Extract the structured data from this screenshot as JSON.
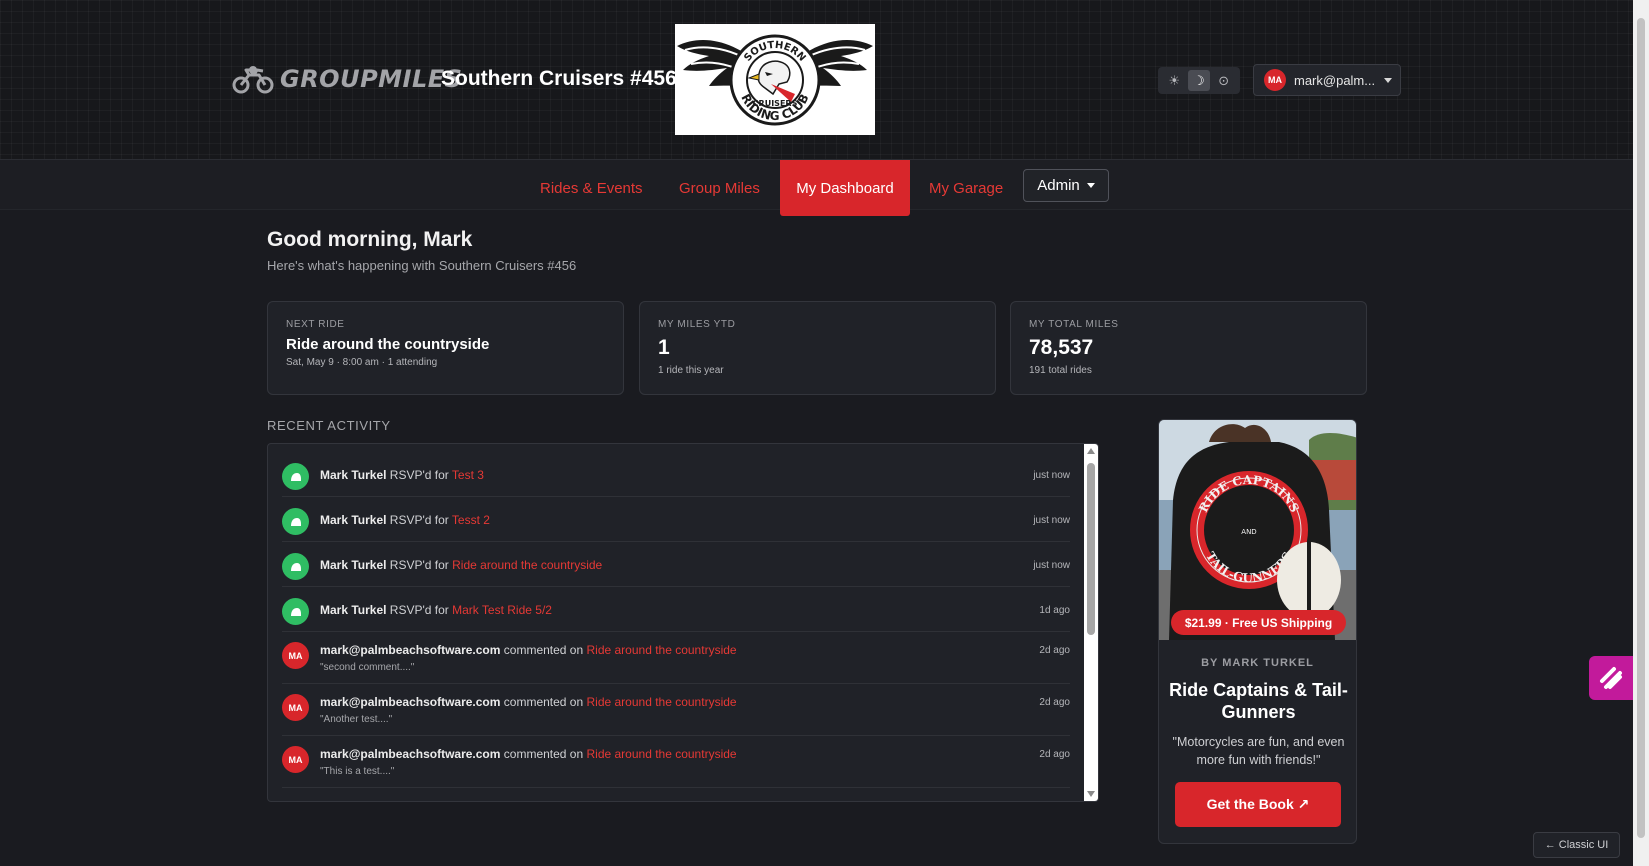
{
  "header": {
    "brand_name": "GROUPMILES",
    "club_name": "Southern Cruisers #456",
    "club_logo": {
      "top_text": "SOUTHERN",
      "center_text": "CRUISERS",
      "bottom_text": "RIDING CLUB"
    },
    "theme_toggle": {
      "light_icon": "sun-icon",
      "dark_icon": "moon-icon",
      "system_icon": "system-icon",
      "active": "dark"
    },
    "user": {
      "avatar_initials": "MA",
      "email": "mark@palm..."
    }
  },
  "nav": {
    "items": [
      {
        "label": "Rides & Events"
      },
      {
        "label": "Group Miles"
      },
      {
        "label": "My Dashboard"
      },
      {
        "label": "My Garage"
      }
    ],
    "active": "My Dashboard",
    "admin_label": "Admin"
  },
  "greeting": {
    "title": "Good morning, Mark",
    "subtitle": "Here's what's happening with Southern Cruisers #456"
  },
  "stats": {
    "next_ride": {
      "label": "NEXT RIDE",
      "title": "Ride around the countryside",
      "meta": "Sat, May 9 · 8:00 am · 1 attending"
    },
    "miles_ytd": {
      "label": "MY MILES YTD",
      "value": "1",
      "sub": "1 ride this year"
    },
    "total_miles": {
      "label": "MY TOTAL MILES",
      "value": "78,537",
      "sub": "191 total rides"
    }
  },
  "activity": {
    "heading": "RECENT ACTIVITY",
    "items": [
      {
        "type": "rsvp",
        "actor": "Mark Turkel",
        "action": " RSVP'd for ",
        "target": "Test 3",
        "time": "just now"
      },
      {
        "type": "rsvp",
        "actor": "Mark Turkel",
        "action": " RSVP'd for ",
        "target": "Tesst 2",
        "time": "just now"
      },
      {
        "type": "rsvp",
        "actor": "Mark Turkel",
        "action": " RSVP'd for ",
        "target": "Ride around the countryside",
        "time": "just now"
      },
      {
        "type": "rsvp",
        "actor": "Mark Turkel",
        "action": " RSVP'd for ",
        "target": "Mark Test Ride 5/2",
        "time": "1d ago"
      },
      {
        "type": "comment",
        "avatar": "MA",
        "actor": "mark@palmbeachsoftware.com",
        "action": " commented on ",
        "target": "Ride around the countryside",
        "quote": "\"second comment....\"",
        "time": "2d ago"
      },
      {
        "type": "comment",
        "avatar": "MA",
        "actor": "mark@palmbeachsoftware.com",
        "action": " commented on ",
        "target": "Ride around the countryside",
        "quote": "\"Another test....\"",
        "time": "2d ago"
      },
      {
        "type": "comment",
        "avatar": "MA",
        "actor": "mark@palmbeachsoftware.com",
        "action": " commented on ",
        "target": "Ride around the countryside",
        "quote": "\"This is a test....\"",
        "time": "2d ago"
      }
    ]
  },
  "promo": {
    "image_text_top": "RIDE CAPTAINS",
    "image_text_middle": "AND",
    "image_text_bottom": "TAIL-GUNNERS",
    "price_badge": "$21.99 · Free US Shipping",
    "author": "BY MARK TURKEL",
    "title": "Ride Captains & Tail-Gunners",
    "quote": "\"Motorcycles are fun, and even more fun with friends!\"",
    "button_label": "Get the Book ↗"
  },
  "footer": {
    "classic_ui_label": "← Classic UI"
  },
  "colors": {
    "accent": "#d8262b",
    "link": "#e53935",
    "rsvp_green": "#2fbd63",
    "background": "#1a1b20",
    "card": "#202228",
    "widget": "#c21a9b"
  }
}
